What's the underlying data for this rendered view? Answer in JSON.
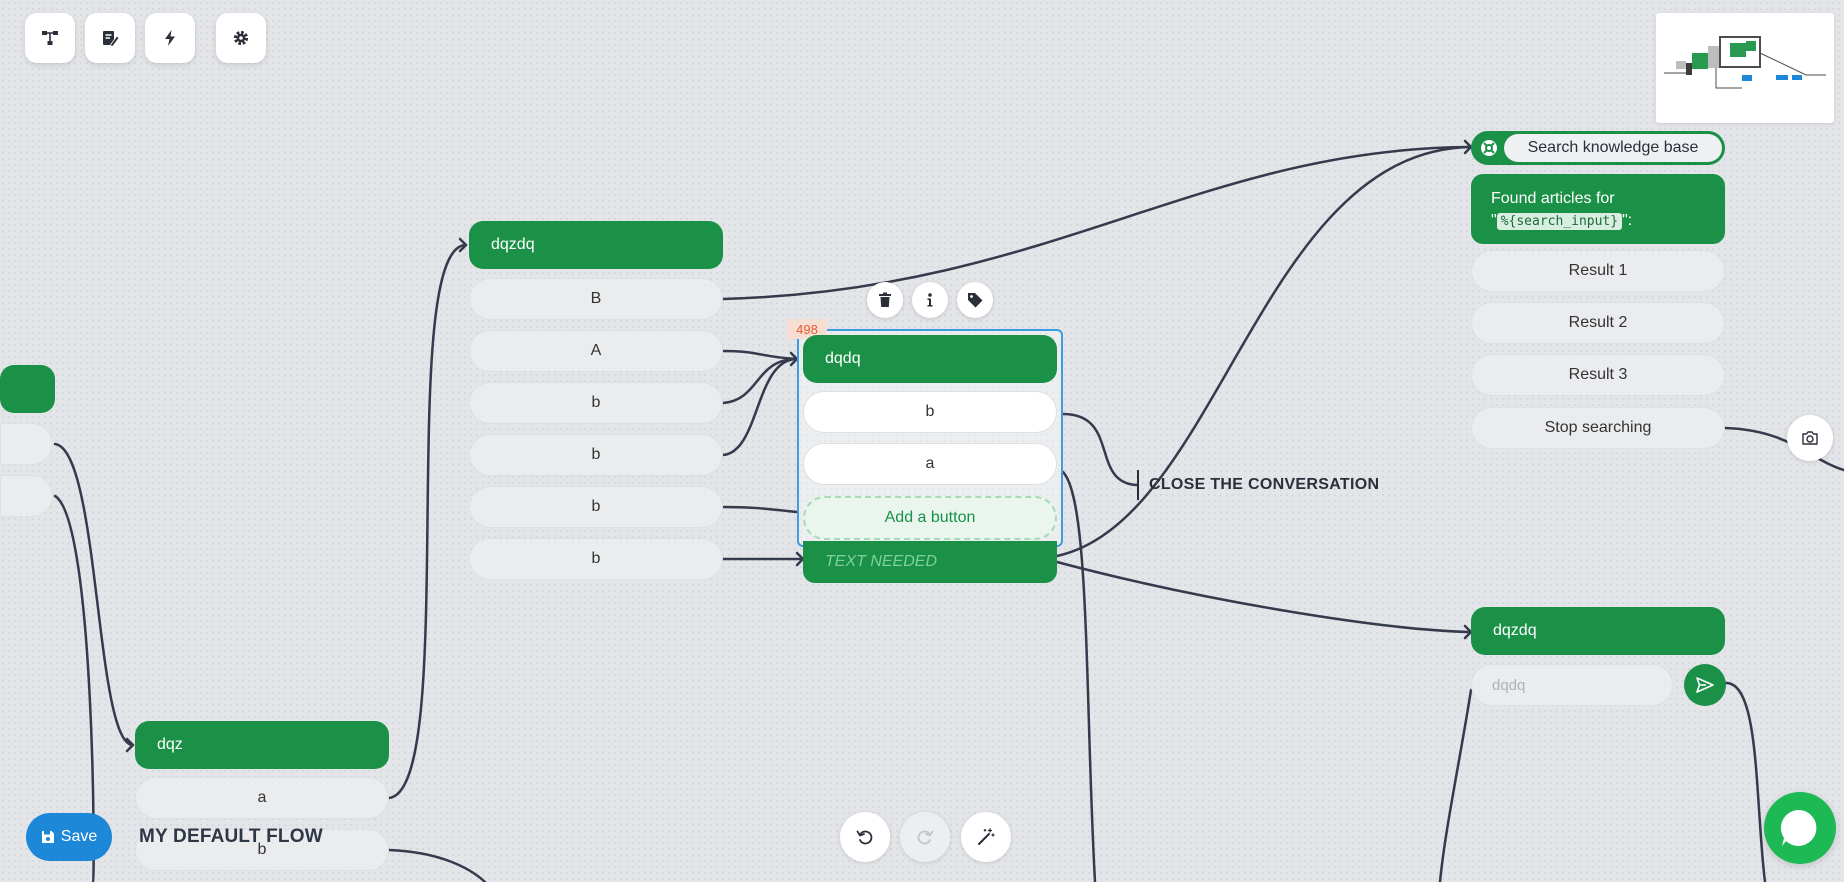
{
  "toolbar": {
    "buttons": [
      "flow-diagram-icon",
      "edit-note-icon",
      "bolt-icon",
      "gear-icon"
    ]
  },
  "nodes": {
    "left_partial": {},
    "dqz": {
      "title": "dqz",
      "buttons": [
        "a",
        "b"
      ]
    },
    "dqzdq_mid": {
      "title": "dqzdq",
      "buttons": [
        "B",
        "A",
        "b",
        "b",
        "b",
        "b"
      ]
    },
    "selected": {
      "id_badge": "498",
      "title": "dqdq",
      "buttons": [
        "b",
        "a"
      ],
      "add_button_label": "Add a button",
      "text_placeholder": "TEXT NEEDED"
    },
    "close_conversation": {
      "label": "CLOSE THE CONVERSATION"
    },
    "knowledge_base": {
      "title": "Search knowledge base",
      "message_prefix": "Found articles for",
      "message_open_quote": "\"",
      "message_var": "%{search_input}",
      "message_suffix": "\":",
      "results": [
        "Result 1",
        "Result 2",
        "Result 3",
        "Stop searching"
      ]
    },
    "dqzdq_right": {
      "title": "dqzdq",
      "input_placeholder": "dqdq"
    }
  },
  "node_actions": [
    "trash-icon",
    "info-icon",
    "tag-icon"
  ],
  "footer": {
    "save_label": "Save",
    "flow_title": "MY DEFAULT FLOW",
    "controls": [
      "undo-icon",
      "redo-icon",
      "magic-wand-icon"
    ]
  },
  "colors": {
    "node_green": "#1a9147",
    "selection_blue": "#3d9be0",
    "save_blue": "#1e88d8",
    "id_badge_orange": "#e55b2e",
    "edge": "#353a4c"
  }
}
